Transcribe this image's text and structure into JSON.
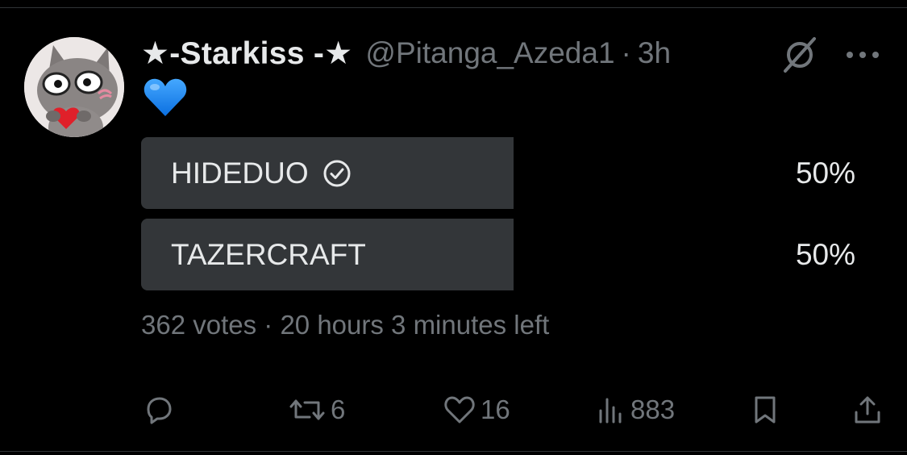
{
  "tweet": {
    "author": {
      "display_name": "★-Starkiss -★",
      "handle": "@Pitanga_Azeda1",
      "separator": "·",
      "time": "3h"
    },
    "body_emoji": "blue-heart"
  },
  "poll": {
    "options": [
      {
        "label": "HIDEDUO",
        "percent": "50%",
        "share": 0.5,
        "selected": true
      },
      {
        "label": "TAZERCRAFT",
        "percent": "50%",
        "share": 0.5,
        "selected": false
      }
    ],
    "votes": "362 votes",
    "separator": "·",
    "time_left": "20 hours 3 minutes left"
  },
  "actions": {
    "reply": {
      "icon": "reply-icon",
      "count": ""
    },
    "retweet": {
      "icon": "retweet-icon",
      "count": "6"
    },
    "like": {
      "icon": "heart-icon",
      "count": "16"
    },
    "views": {
      "icon": "views-icon",
      "count": "883"
    },
    "bookmark": {
      "icon": "bookmark-icon"
    },
    "share": {
      "icon": "share-icon"
    }
  },
  "colors": {
    "background": "#000000",
    "text_primary": "#e7e9ea",
    "text_secondary": "#71767b",
    "poll_bar": "#333639",
    "heart_blue": "#1d8cf8"
  }
}
